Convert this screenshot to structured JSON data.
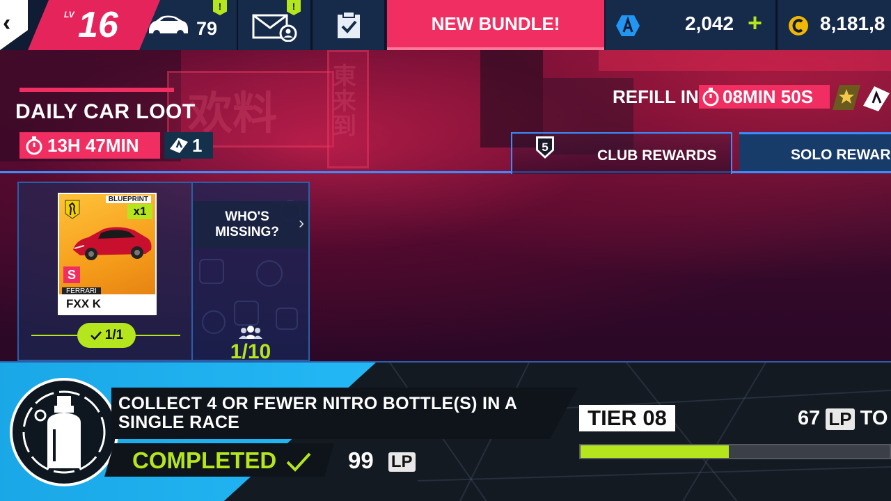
{
  "topbar": {
    "back_label": "‹",
    "level_prefix": "LV",
    "level": "16",
    "cars_count": "79",
    "garage_alert": "!",
    "mail_alert": "!",
    "bundle_label": "NEW BUNDLE!",
    "tokens": "2,042",
    "tokens_add": "+",
    "credits": "8,181,8"
  },
  "loot": {
    "title": "DAILY CAR LOOT",
    "timer": "13H 47MIN",
    "tickets": "1",
    "refill_label": "REFILL IN",
    "refill_timer": "08MIN 50S"
  },
  "tabs": {
    "club_badge": "5",
    "club_label": "CLUB REWARDS",
    "solo_label": "SOLO REWARD"
  },
  "card": {
    "type_label": "BLUEPRINT",
    "count": "x1",
    "rank": "S",
    "maker": "FERRARI",
    "model": "FXX K",
    "progress": "1/1",
    "progress_fraction": 1.0
  },
  "club": {
    "missing_label": "WHO'S MISSING?",
    "members": "1/10"
  },
  "mission": {
    "description": "COLLECT 4 OR FEWER NITRO BOTTLE(S) IN A SINGLE RACE",
    "status": "COMPLETED",
    "reward_value": "99",
    "reward_unit": "LP"
  },
  "tier": {
    "label": "TIER 08",
    "lp_needed": "67",
    "lp_unit": "LP",
    "lp_suffix": "TO",
    "progress_fraction": 0.48
  },
  "colors": {
    "accent_pink": "#f02e62",
    "accent_lime": "#b5e61d",
    "accent_blue": "#3a8cff"
  }
}
